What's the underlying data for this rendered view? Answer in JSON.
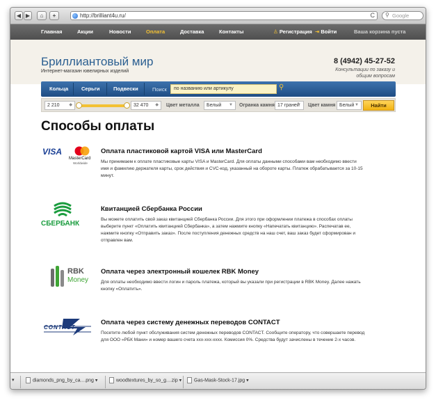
{
  "browser": {
    "url": "http://brilliant4u.ru/",
    "search_placeholder": "Google",
    "back": "◀",
    "forward": "▶",
    "home": "⌂",
    "add": "+",
    "reload": "C"
  },
  "nav": {
    "items": [
      "Главная",
      "Акции",
      "Новости",
      "Оплата",
      "Доставка",
      "Контакты"
    ],
    "register": "Регистрация",
    "login": "Войти",
    "cart": "Ваша корзина пуста"
  },
  "header": {
    "title": "Бриллиантовый мир",
    "subtitle": "Интернет-магазин ювелирных изделий",
    "phone": "8 (4942) 45-27-52",
    "phone_note": "Консультации по заказу и общим вопросам"
  },
  "catalog": {
    "items": [
      "Кольца",
      "Серьги",
      "Подвески"
    ],
    "search_label": "Поиск",
    "search_placeholder": "по названию или артикулу"
  },
  "filter": {
    "price_min": "2 210",
    "price_max": "32 470",
    "metal_label": "Цвет металла",
    "metal_value": "Белый",
    "cut_label": "Огранка камня",
    "cut_value": "17 граней",
    "stone_label": "Цвет камня",
    "stone_value": "Белый",
    "find_label": "Найти"
  },
  "page": {
    "title": "Способы оплаты"
  },
  "methods": [
    {
      "title": "Оплата пластиковой картой VISA или MasterCard",
      "description": "Мы принимаем к оплате пластиковые карты VISA и MasterCard. Для оплаты данными способами вам необходимо ввести имя и фамилию держателя карты, срок действия и CVC-код, указанный на обороте карты. Платеж обрабатывается за 10-15 минут."
    },
    {
      "title": "Квитанцией Сбербанка России",
      "description": "Вы можете оплатить свой заказ квитанцией Сбербанка России. Для этого при оформлении платежа в способах оплаты выберите пункт «Оплатить квитанцией Сбербанка», а затем нажмите кнопку «Напечатать квитанцию». Распечатав ее, нажмите кнопку «Отправить заказ». После поступления денежных средств на наш счет, ваш заказ будет сформирован и отправлен вам."
    },
    {
      "title": "Оплата через электронный кошелек RBK Money",
      "description": "Для оплаты необходимо ввести логин и пароль платежа, который вы указали при регистрации в RBK Money. Далее нажать кнопку «Оплатить»."
    },
    {
      "title": "Оплата через систему денежных переводов CONTACT",
      "description": "Посетите любой пункт обслуживания систем денежных переводов CONTACT. Сообщите оператору, что совершаете перевод для ООО «РБК Мани» и номер вашего счета xxx-xxx-xxxx. Комиссия 0%. Средства будут зачислены в течение 2-х часов."
    }
  ],
  "logos": {
    "visa": "VISA",
    "mastercard": "MasterCard",
    "mastercard_sub": "Worldwide",
    "sberbank": "СБЕРБАНК",
    "rbk": "RBK",
    "rbk_money": "Money",
    "contact": "CONTACT"
  },
  "downloads": [
    "diamonds_png_by_ca....png",
    "woodtextures_by_so_g....zip",
    "Gas-Mask-Stock-17.jpg"
  ],
  "colors": {
    "accent_yellow": "#f3c133",
    "brand_blue": "#2b5f91",
    "catalog_blue": "#2a5c96",
    "sber_green": "#1a9c3e"
  }
}
